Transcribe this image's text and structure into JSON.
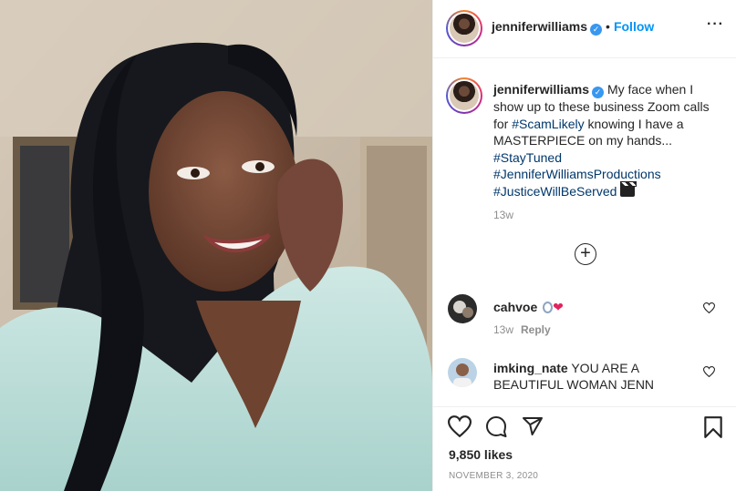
{
  "post": {
    "username": "jenniferwilliams",
    "verified_mark": "✓",
    "follow_label": "Follow",
    "separator": "•",
    "more_label": "···",
    "caption_username": "jenniferwilliams",
    "caption_text": "My face when I show up to these business Zoom calls for",
    "caption_tag_1": "#ScamLikely",
    "caption_text_2": "knowing I have a MASTERPIECE on my hands...",
    "caption_tag_2": "#StayTuned",
    "caption_tag_3": "#JenniferWilliamsProductions",
    "caption_tag_4": "#JusticeWillBeServed",
    "caption_emoji": "clapper-board-emoji",
    "caption_time": "13w",
    "load_more_label": "+"
  },
  "comments": [
    {
      "username": "cahvoe",
      "text": "",
      "emojis": [
        "ring-emoji",
        "red-heart-emoji"
      ],
      "heart_glyph": "❤",
      "time": "13w",
      "reply_label": "Reply"
    },
    {
      "username": "imking_nate",
      "text": "YOU ARE A BEAUTIFUL WOMAN JENN"
    }
  ],
  "actions": {
    "icons": [
      "like-heart-icon",
      "comment-icon",
      "share-icon",
      "save-bookmark-icon"
    ],
    "likes": "9,850 likes",
    "date": "NOVEMBER 3, 2020"
  },
  "colors": {
    "link_blue": "#0095f6",
    "hashtag": "#00376b",
    "muted": "#8e8e8e",
    "divider": "#efefef"
  }
}
